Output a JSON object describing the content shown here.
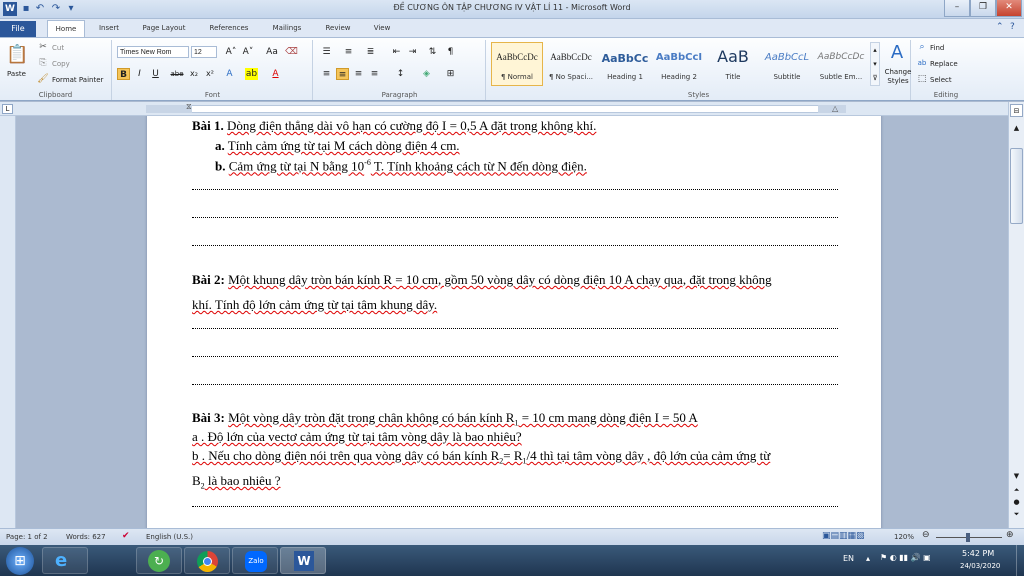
{
  "window": {
    "title": "ĐỀ CƯƠNG ÔN TẬP CHƯƠNG IV VẬT LÍ 11 - Microsoft Word",
    "minimize": "–",
    "restore": "❐",
    "close": "✕"
  },
  "tabs": [
    {
      "label": "File"
    },
    {
      "label": "Home"
    },
    {
      "label": "Insert"
    },
    {
      "label": "Page Layout"
    },
    {
      "label": "References"
    },
    {
      "label": "Mailings"
    },
    {
      "label": "Review"
    },
    {
      "label": "View"
    }
  ],
  "clipboard": {
    "paste": "Paste",
    "cut": "Cut",
    "copy": "Copy",
    "format_painter": "Format Painter",
    "group": "Clipboard"
  },
  "font": {
    "name": "Times New Rom",
    "size": "12",
    "bold": "B",
    "italic": "I",
    "underline": "U",
    "strike": "abe",
    "subscript": "x₂",
    "superscript": "x²",
    "grow": "A˄",
    "shrink": "A˅",
    "change_case": "Aa",
    "group": "Font"
  },
  "paragraph": {
    "group": "Paragraph"
  },
  "styles": {
    "items": [
      {
        "preview": "AaBbCcDc",
        "name": "¶ Normal",
        "selected": true
      },
      {
        "preview": "AaBbCcDc",
        "name": "¶ No Spaci..."
      },
      {
        "preview": "AaBbCc",
        "name": "Heading 1"
      },
      {
        "preview": "AaBbCcI",
        "name": "Heading 2"
      },
      {
        "preview": "AaB",
        "name": "Title"
      },
      {
        "preview": "AaBbCcL",
        "name": "Subtitle"
      },
      {
        "preview": "AaBbCcDc",
        "name": "Subtle Em..."
      }
    ],
    "change_styles": "Change Styles",
    "group": "Styles"
  },
  "editing": {
    "find": "Find",
    "replace": "Replace",
    "select": "Select",
    "group": "Editing"
  },
  "document": {
    "b1_title": "Bài 1.",
    "b1_text": "Dòng điện thẳng dài vô hạn có cường độ I = 0,5 A đặt trong không khí.",
    "b1_a_lbl": "a.",
    "b1_a": "Tính cảm ứng từ tại M cách dòng điện 4 cm.",
    "b1_b_lbl": "b.",
    "b1_b_1": "Cảm ứng từ tại N bằng 10",
    "b1_b_sup": "-6",
    "b1_b_2": " T. Tính khoảng cách từ N đến dòng điện.",
    "b2_title": "Bài 2:",
    "b2_line1": "Một khung dây tròn bán kính R = 10 cm, gồm 50 vòng dây có dòng điện 10 A chạy qua, đặt trong không",
    "b2_line2": "khí. Tính độ lớn cảm ứng từ tại tâm khung dây.",
    "b3_title": "Bài 3:",
    "b3_line1a": "Một vòng dây tròn đặt trong chân không có bán kính R",
    "b3_sub1": "1",
    "b3_line1b": " = 10 cm mang dòng điện I = 50 A",
    "b3_a": "a . Độ lớn của vectơ cảm ứng từ tại tâm vòng dây là bao nhiêu?",
    "b3_b_1": "b . Nếu cho dòng điện nói trên qua vòng dây có bán kính R",
    "b3_b_sub2": "2",
    "b3_b_2": "= R",
    "b3_b_sub3": "1",
    "b3_b_3": "/4  thì tại tâm vòng dây , độ lớn của cảm ứng từ",
    "b3_c_1": "B",
    "b3_c_sub": "2",
    "b3_c_2": " là bao nhiêu ?"
  },
  "status": {
    "page": "Page: 1 of 2",
    "words": "Words: 627",
    "language": "English (U.S.)",
    "zoom": "120%"
  },
  "taskbar": {
    "lang": "EN",
    "time": "5:42 PM",
    "date": "24/03/2020",
    "zalo": "Zalo"
  },
  "colors": {
    "accent": "#2b579a",
    "ribbon": "#e3ecf7",
    "page": "#ffffff"
  }
}
